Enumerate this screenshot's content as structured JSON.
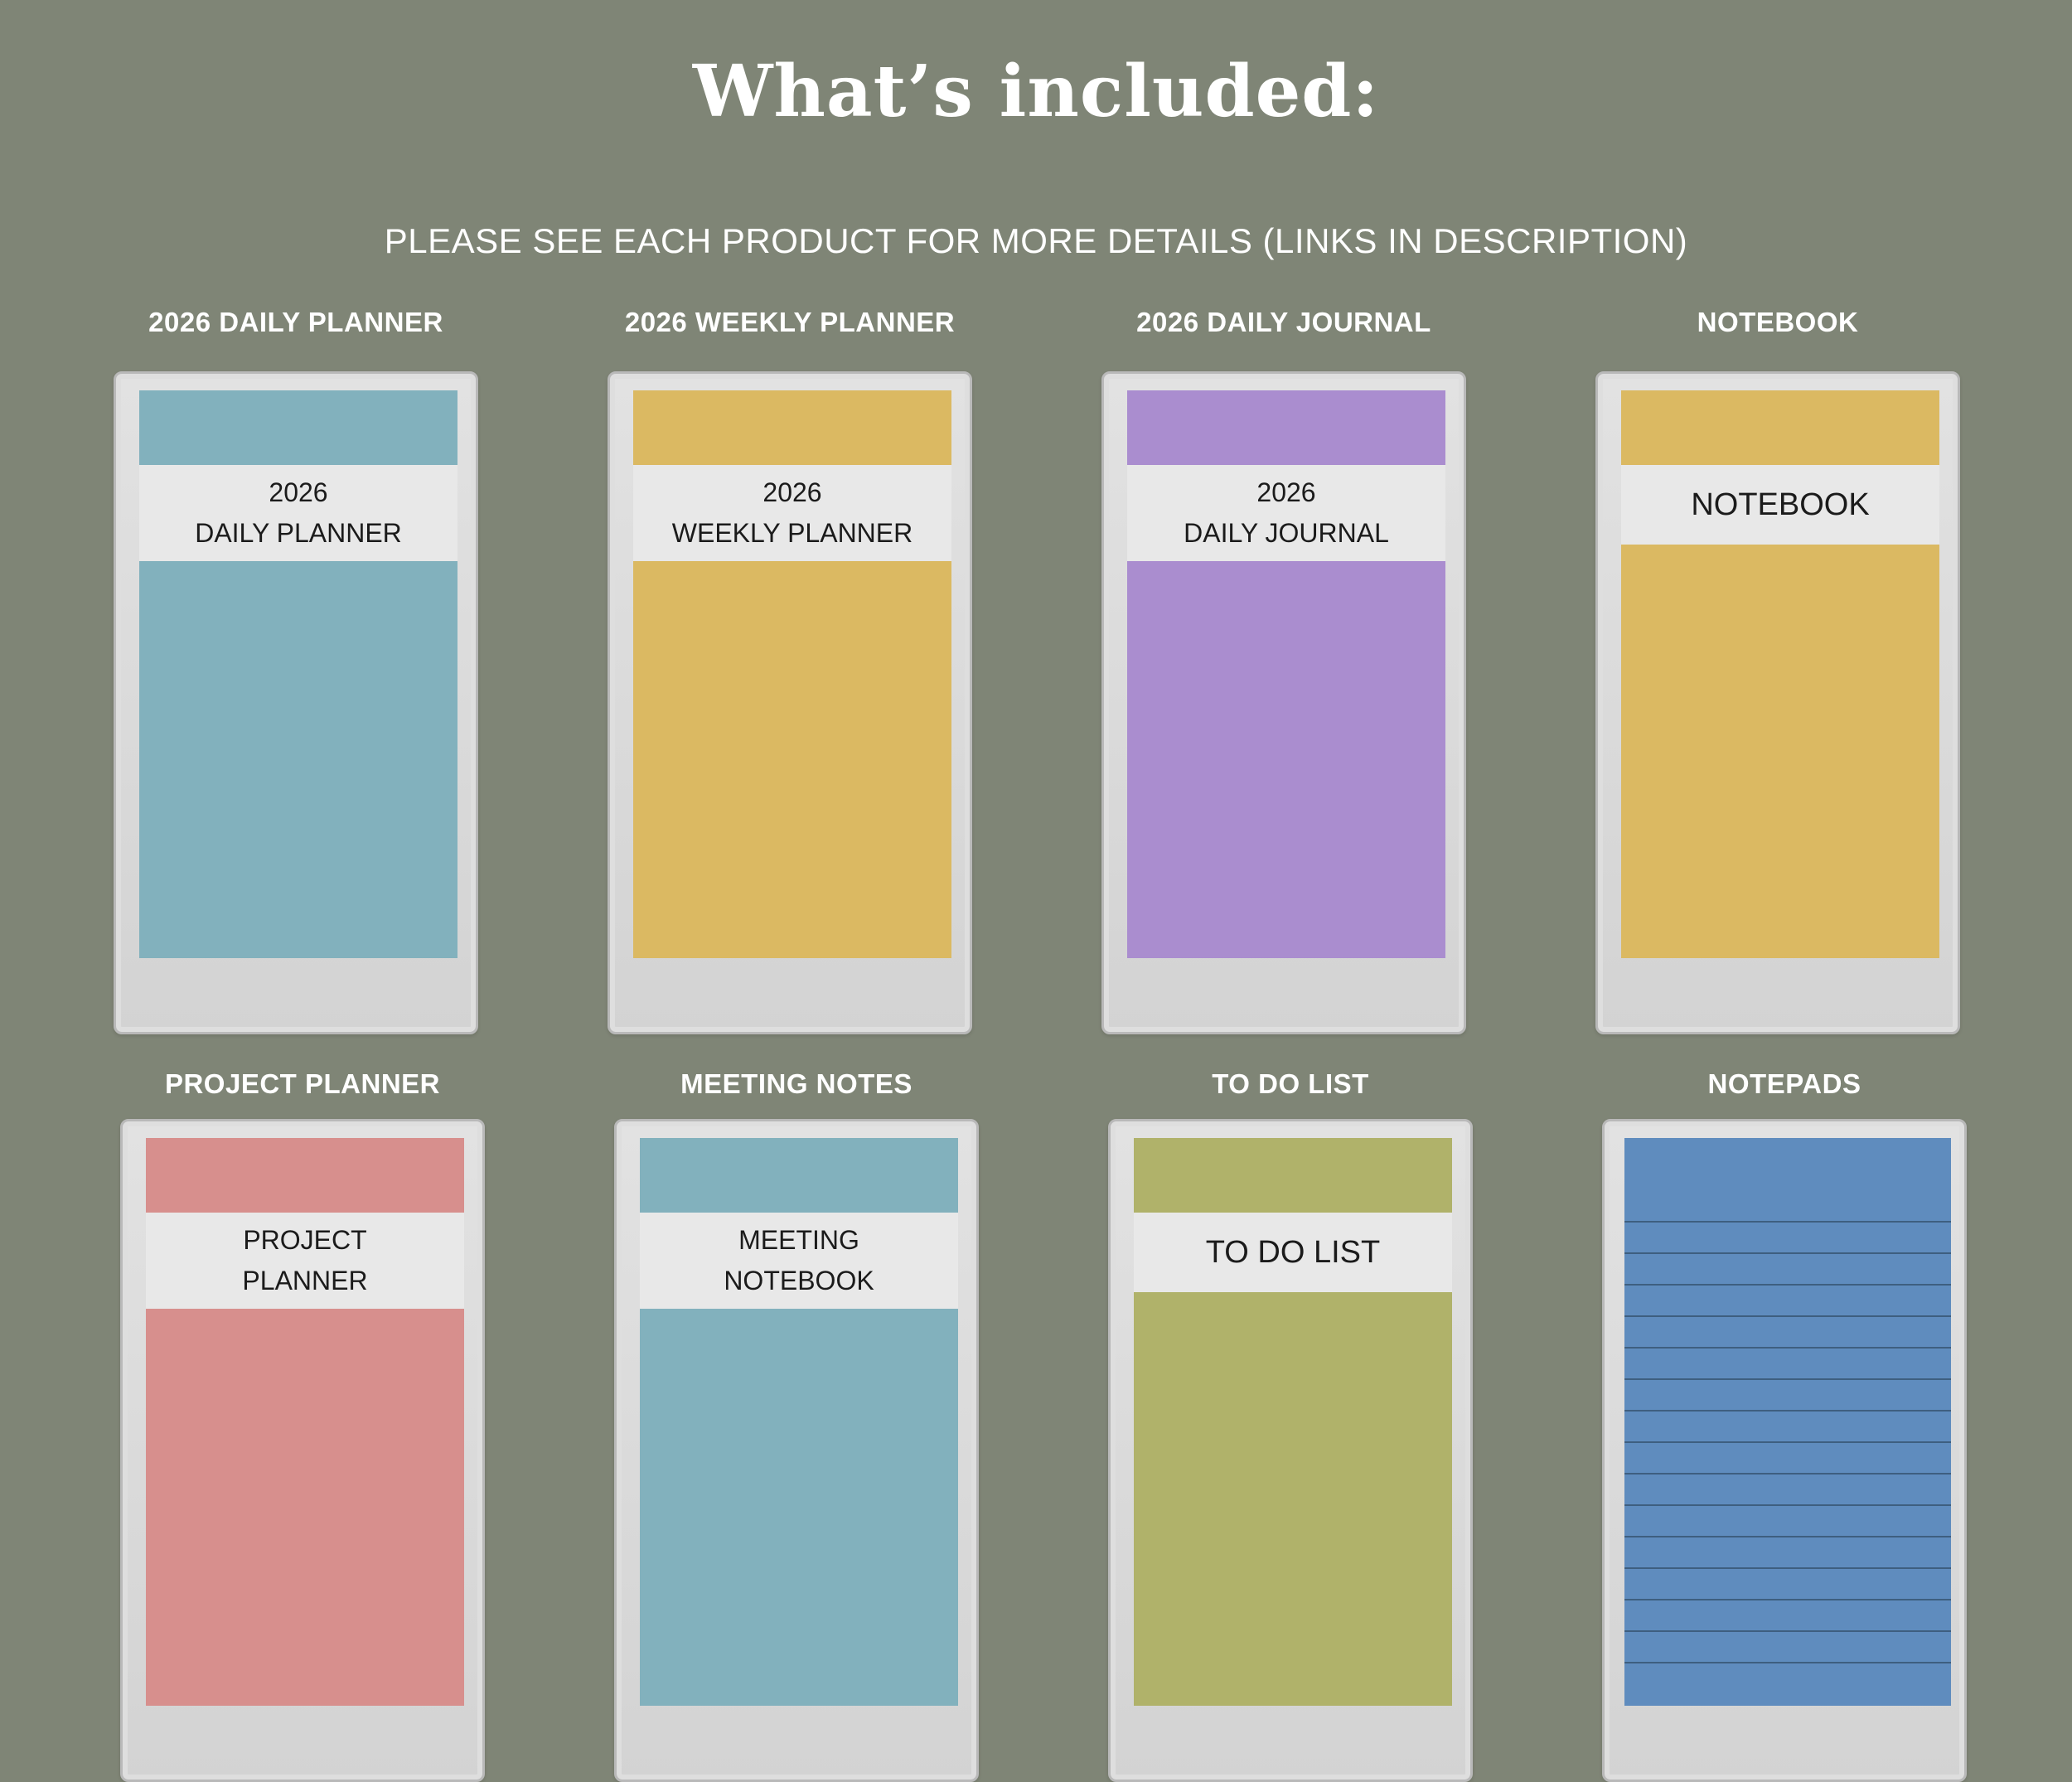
{
  "header": {
    "title": "What’s included:",
    "subtitle": "PLEASE SEE EACH PRODUCT FOR MORE DETAILS (LINKS IN DESCRIPTION)"
  },
  "products": [
    {
      "label": "2026 DAILY PLANNER",
      "cover_lines": [
        "2026",
        "DAILY PLANNER"
      ],
      "color": "#82b1bd"
    },
    {
      "label": "2026 WEEKLY PLANNER",
      "cover_lines": [
        "2026",
        "WEEKLY PLANNER"
      ],
      "color": "#dbb962"
    },
    {
      "label": "2026 DAILY JOURNAL",
      "cover_lines": [
        "2026",
        "DAILY JOURNAL"
      ],
      "color": "#aa8dcf"
    },
    {
      "label": "NOTEBOOK",
      "cover_lines": [
        "NOTEBOOK"
      ],
      "color": "#dbb962"
    },
    {
      "label": "PROJECT PLANNER",
      "cover_lines": [
        "PROJECT",
        "PLANNER"
      ],
      "color": "#d78f8d"
    },
    {
      "label": "MEETING NOTES",
      "cover_lines": [
        "MEETING",
        "NOTEBOOK"
      ],
      "color": "#82b1bd"
    },
    {
      "label": "TO DO LIST",
      "cover_lines": [
        "TO DO LIST"
      ],
      "color": "#b0b26a"
    },
    {
      "label": "NOTEPADS",
      "cover_lines": [],
      "color": "#5f8cbe",
      "icon": "lined-paper"
    }
  ]
}
